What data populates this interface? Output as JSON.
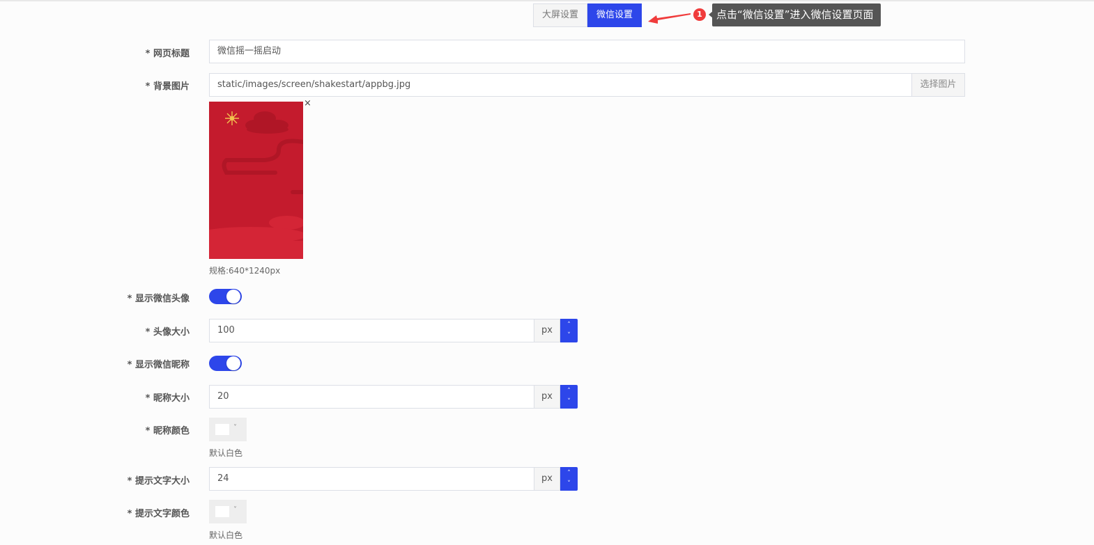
{
  "tabs": [
    {
      "label": "大屏设置",
      "active": false
    },
    {
      "label": "微信设置",
      "active": true
    }
  ],
  "annotation": {
    "badge": "1",
    "text": "点击“微信设置”进入微信设置页面",
    "arrow_color": "#f03c3c"
  },
  "form": {
    "page_title": {
      "label": "* 网页标题",
      "value": "微信摇一摇启动"
    },
    "background": {
      "label": "* 背景图片",
      "value": "static/images/screen/shakestart/appbg.jpg",
      "choose_button": "选择图片",
      "remove": "×",
      "spec": "规格:640*1240px"
    },
    "show_avatar": {
      "label": "* 显示微信头像",
      "on": true
    },
    "avatar_size": {
      "label": "* 头像大小",
      "value": "100",
      "unit": "px"
    },
    "show_nickname": {
      "label": "* 显示微信昵称",
      "on": true
    },
    "nickname_size": {
      "label": "* 昵称大小",
      "value": "20",
      "unit": "px"
    },
    "nickname_color": {
      "label": "* 昵称颜色",
      "color": "#ffffff",
      "hint": "默认白色"
    },
    "tip_text_size": {
      "label": "* 提示文字大小",
      "value": "24",
      "unit": "px"
    },
    "tip_text_color": {
      "label": "* 提示文字颜色",
      "color": "#ffffff",
      "hint": "默认白色"
    }
  },
  "colors": {
    "primary": "#2d46ea",
    "image_red": "#c41b2d"
  }
}
